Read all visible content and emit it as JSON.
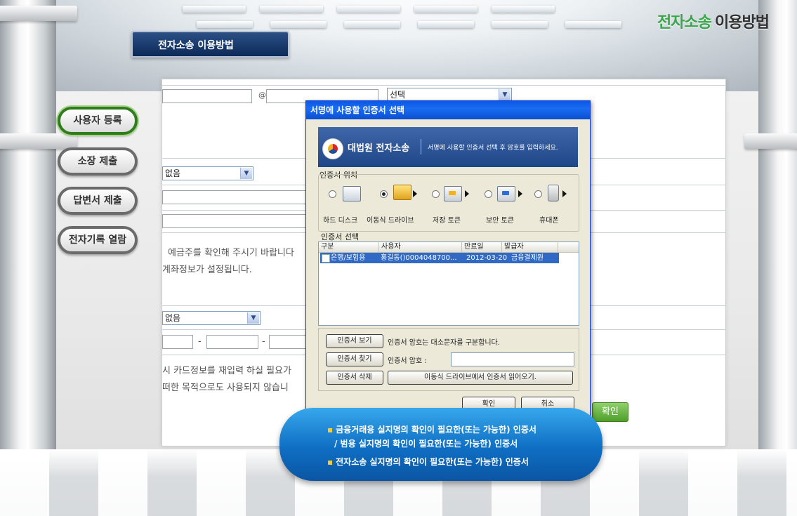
{
  "header": {
    "title_green": "전자소송",
    "title_dark": "이용방법",
    "banner_title": "전자소송 이용방법"
  },
  "nav": {
    "items": [
      {
        "label": "사용자 등록"
      },
      {
        "label": "소장 제출"
      },
      {
        "label": "답변서 제출"
      },
      {
        "label": "전자기록 열람"
      }
    ]
  },
  "form": {
    "at_sign": "@",
    "email_domain_select": "선택",
    "select_none_1": "없음",
    "select_none_2": "없음",
    "text_account_1": "예금주를 확인해 주시기 바랍니다",
    "text_account_2": "계좌정보가 설정됩니다.",
    "dash": "-",
    "text_card_1": "시 카드정보를 재입력 하실 필요가",
    "text_card_2": "떠한 목적으로도 사용되지 않습니",
    "confirm_button": "확인"
  },
  "dialog": {
    "title": "서명에 사용할 인증서 선택",
    "org": "대법원 전자소송",
    "instruction": "서명에 사용할 인증서 선택 후 암호를 입력하세요.",
    "location_label": "인증서 위치",
    "devices": [
      {
        "label": "하드 디스크",
        "icon": "hard-disk-icon"
      },
      {
        "label": "이동식 드라이브",
        "icon": "removable-drive-icon"
      },
      {
        "label": "저장 토큰",
        "icon": "storage-token-icon"
      },
      {
        "label": "보안 토큰",
        "icon": "security-token-icon"
      },
      {
        "label": "휴대폰",
        "icon": "mobile-phone-icon"
      }
    ],
    "select_label": "인증서 선택",
    "columns": [
      "구분",
      "사용자",
      "만료일",
      "발급자"
    ],
    "cert_row": {
      "type": "은행/보험용",
      "user": "홍길동()0004048700...",
      "expiry": "2012-03-20",
      "issuer": "금융결제원"
    },
    "view_button": "인증서 보기",
    "case_note": "인증서 암호는 대소문자를 구분합니다.",
    "find_button": "인증서 찾기",
    "password_label": "인증서 암호 :",
    "delete_button": "인증서 삭제",
    "read_note": "이동식 드라이브에서 인증서 읽어오기.",
    "ok_button": "확인",
    "cancel_button": "취소"
  },
  "callout": {
    "line1": "금융거래용 실지명의 확인이 필요한(또는 가능한) 인증서",
    "line2": "/ 범용 실지명의 확인이 필요한(또는 가능한) 인증서",
    "line3": "전자소송 실지명의 확인이 필요한(또는 가능한) 인증서"
  },
  "colors": {
    "accent_green": "#3aa54a",
    "dialog_title_blue": "#0a58e4",
    "callout_blue": "#0f6fc3",
    "selection_blue": "#316ac5"
  }
}
